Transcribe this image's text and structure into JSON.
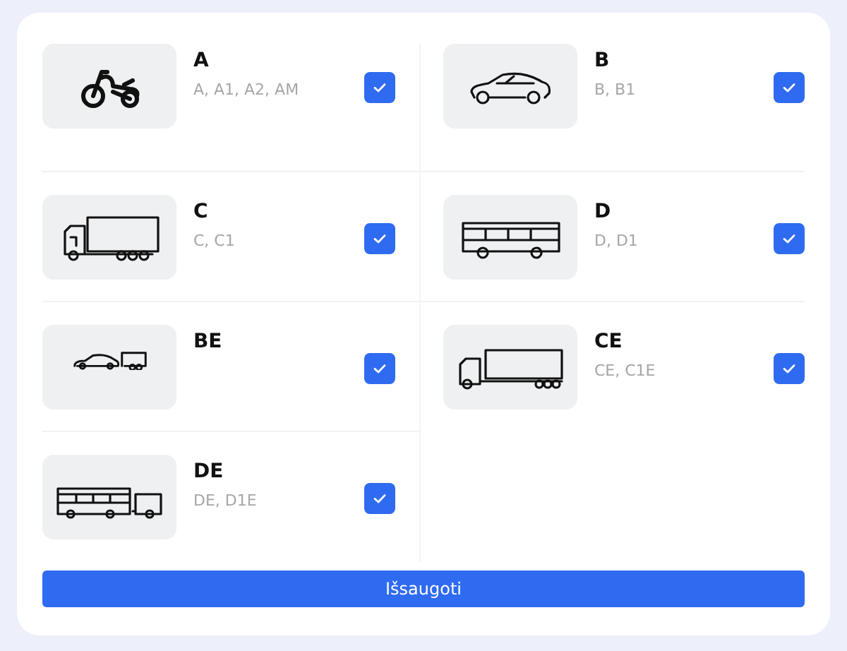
{
  "categories": [
    {
      "kind": "motorcycle",
      "title": "A",
      "subtitle": "A, A1, A2, AM",
      "checked": true
    },
    {
      "kind": "car",
      "title": "B",
      "subtitle": "B, B1",
      "checked": true
    },
    {
      "kind": "truck",
      "title": "C",
      "subtitle": "C, C1",
      "checked": true
    },
    {
      "kind": "bus",
      "title": "D",
      "subtitle": "D, D1",
      "checked": true
    },
    {
      "kind": "car-trailer",
      "title": "BE",
      "checked": true
    },
    {
      "kind": "truck-trailer",
      "title": "CE",
      "subtitle": "CE, C1E",
      "checked": true
    },
    {
      "kind": "bus-trailer",
      "title": "DE",
      "subtitle": "DE, D1E",
      "checked": true
    }
  ],
  "save_button": "Išsaugoti"
}
